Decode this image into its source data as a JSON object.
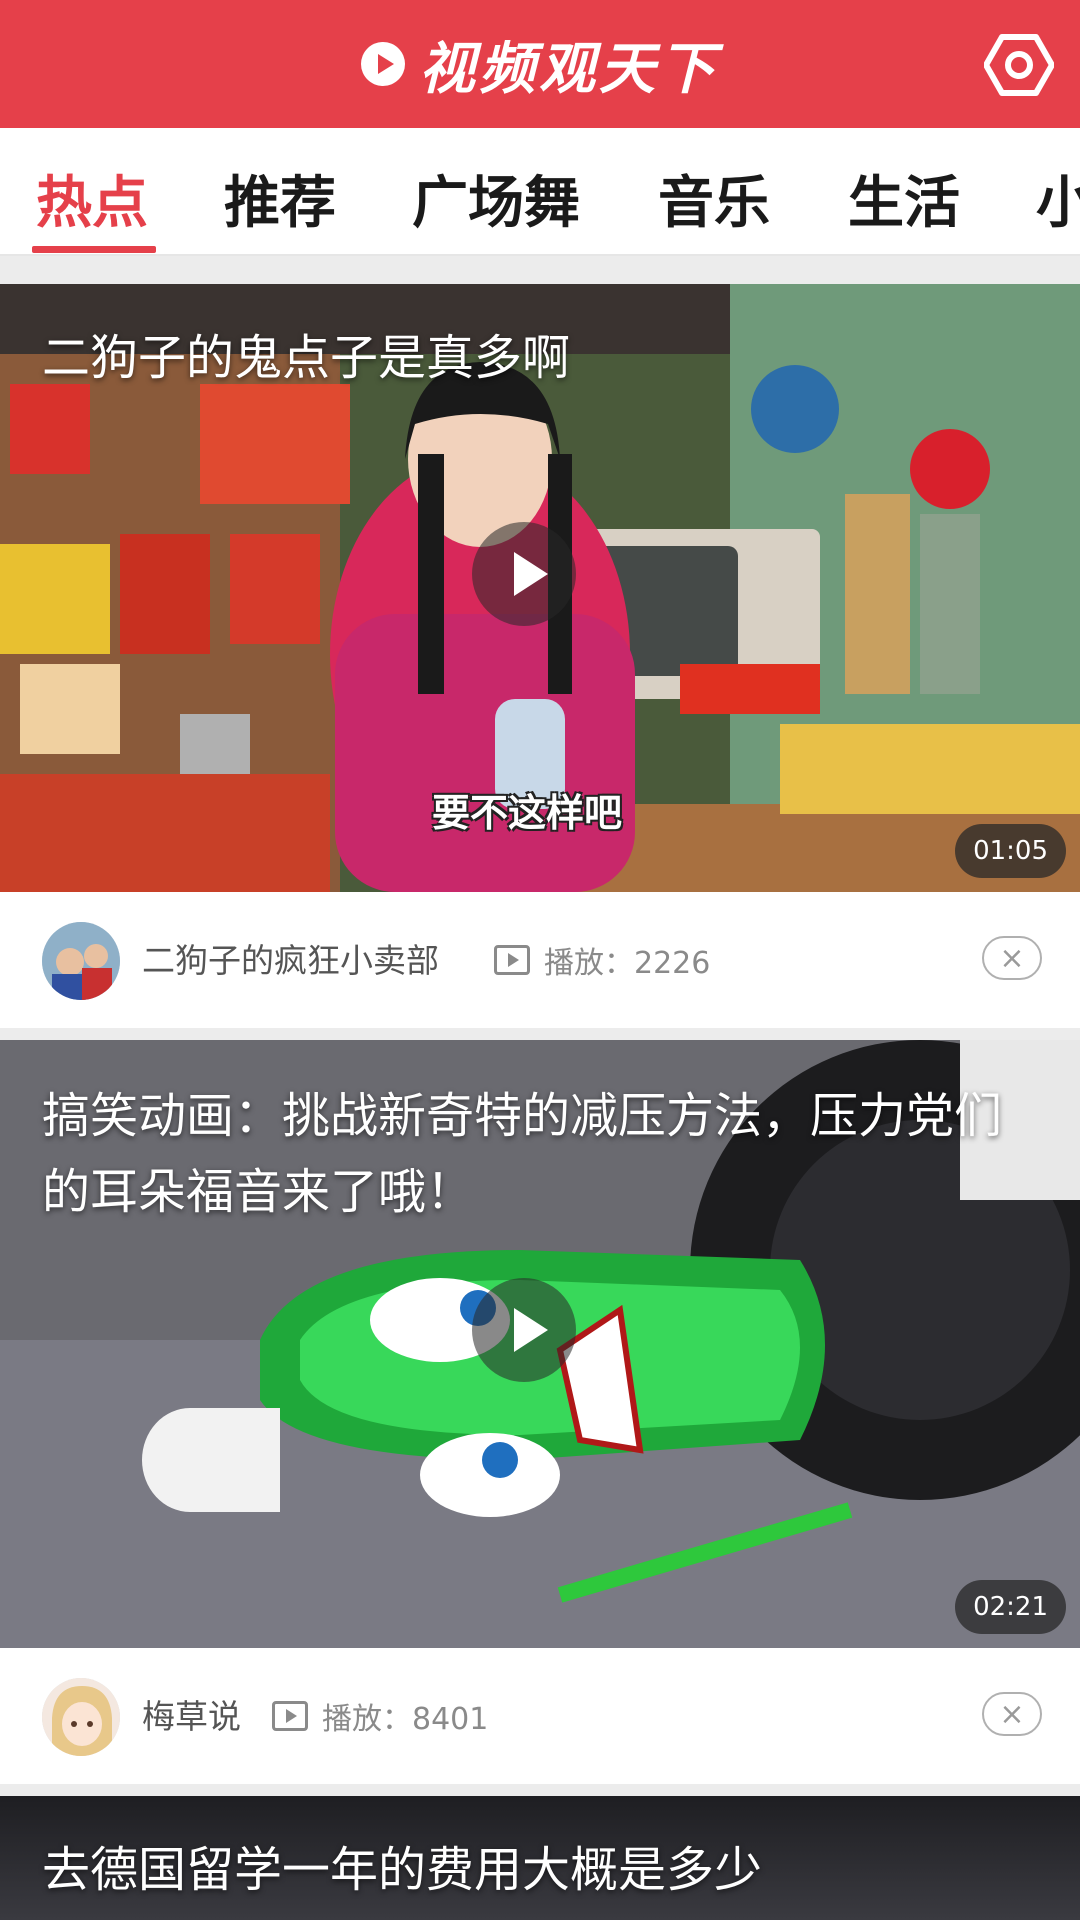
{
  "header": {
    "title": "视频观天下",
    "logo_icon": "play-circle-icon",
    "settings_icon": "settings-icon",
    "color": "#e5404a"
  },
  "tabs": [
    {
      "label": "热点",
      "active": true
    },
    {
      "label": "推荐",
      "active": false
    },
    {
      "label": "广场舞",
      "active": false
    },
    {
      "label": "音乐",
      "active": false
    },
    {
      "label": "生活",
      "active": false
    },
    {
      "label": "小",
      "active": false
    }
  ],
  "videos": [
    {
      "title": "二狗子的鬼点子是真多啊",
      "caption": "要不这样吧",
      "duration": "01:05",
      "author": "二狗子的疯狂小卖部",
      "plays": "播放：2226"
    },
    {
      "title": "搞笑动画：挑战新奇特的减压方法，压力党们的耳朵福音来了哦！",
      "duration": "02:21",
      "author": "梅草说",
      "plays": "播放：8401"
    },
    {
      "title": "去德国留学一年的费用大概是多少"
    }
  ],
  "close_label": "×"
}
